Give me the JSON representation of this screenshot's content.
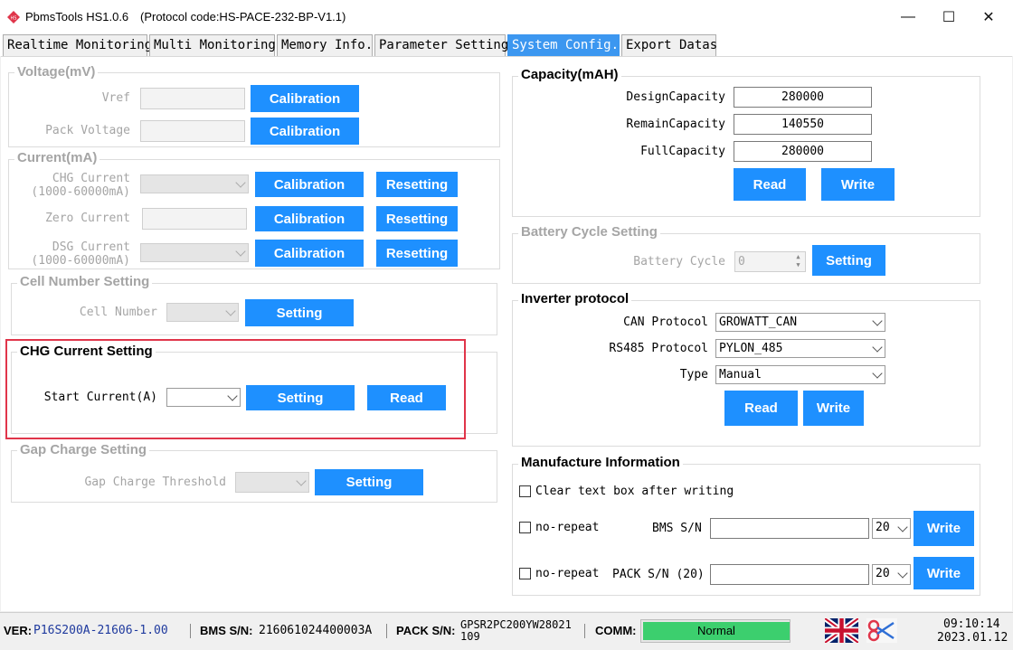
{
  "window": {
    "app_title": "PbmsTools HS1.0.6",
    "protocol_title": "(Protocol code:HS-PACE-232-BP-V1.1)",
    "minimize": "—",
    "maximize": "☐",
    "close": "✕"
  },
  "tabs": [
    {
      "label": "Realtime Monitoring"
    },
    {
      "label": "Multi Monitoring"
    },
    {
      "label": "Memory Info."
    },
    {
      "label": "Parameter Setting"
    },
    {
      "label": "System Config."
    },
    {
      "label": "Export Datas"
    }
  ],
  "voltage": {
    "title": "Voltage(mV)",
    "vref_label": "Vref",
    "pack_voltage_label": "Pack Voltage",
    "calibration": "Calibration"
  },
  "current": {
    "title": "Current(mA)",
    "chg_label_1": "CHG Current",
    "chg_label_2": "(1000-60000mA)",
    "zero_label": "Zero Current",
    "dsg_label_1": "DSG Current",
    "dsg_label_2": "(1000-60000mA)",
    "calibration": "Calibration",
    "resetting": "Resetting"
  },
  "cell_number": {
    "title": "Cell Number Setting",
    "label": "Cell Number",
    "setting": "Setting"
  },
  "chg_current": {
    "title": "CHG Current Setting",
    "label": "Start Current(A)",
    "setting": "Setting",
    "read": "Read"
  },
  "gap_charge": {
    "title": "Gap Charge Setting",
    "label": "Gap Charge Threshold",
    "setting": "Setting"
  },
  "capacity": {
    "title": "Capacity(mAH)",
    "design_label": "DesignCapacity",
    "design_value": "280000",
    "remain_label": "RemainCapacity",
    "remain_value": "140550",
    "full_label": "FullCapacity",
    "full_value": "280000",
    "read": "Read",
    "write": "Write"
  },
  "battery_cycle": {
    "title": "Battery Cycle Setting",
    "label": "Battery Cycle",
    "value": "0",
    "setting": "Setting"
  },
  "inverter": {
    "title": "Inverter protocol",
    "can_label": "CAN Protocol",
    "can_value": "GROWATT_CAN",
    "rs485_label": "RS485 Protocol",
    "rs485_value": "PYLON_485",
    "type_label": "Type",
    "type_value": "Manual",
    "read": "Read",
    "write": "Write"
  },
  "manufacture": {
    "title": "Manufacture Information",
    "clear_label": "Clear text box after writing",
    "norepeat_label": "no-repeat",
    "bms_sn_label": "BMS S/N",
    "bms_sn_len": "20",
    "pack_sn_label": "PACK S/N (20)",
    "pack_sn_len": "20",
    "write": "Write"
  },
  "status": {
    "ver_label": "VER:",
    "ver_value": "P16S200A-21606-1.00",
    "bms_label": "BMS S/N:",
    "bms_value": "216061024400003A",
    "pack_label": "PACK S/N:",
    "pack_value_1": "GPSR2PC200YW28021",
    "pack_value_2": "109",
    "comm_label": "COMM:",
    "comm_value": "Normal",
    "time": "09:10:14",
    "date": "2023.01.12"
  },
  "colors": {
    "accent": "#1e90ff",
    "active_tab": "#3c97f0",
    "highlight": "#e0354a",
    "comm_ok": "#3ccf6e"
  }
}
